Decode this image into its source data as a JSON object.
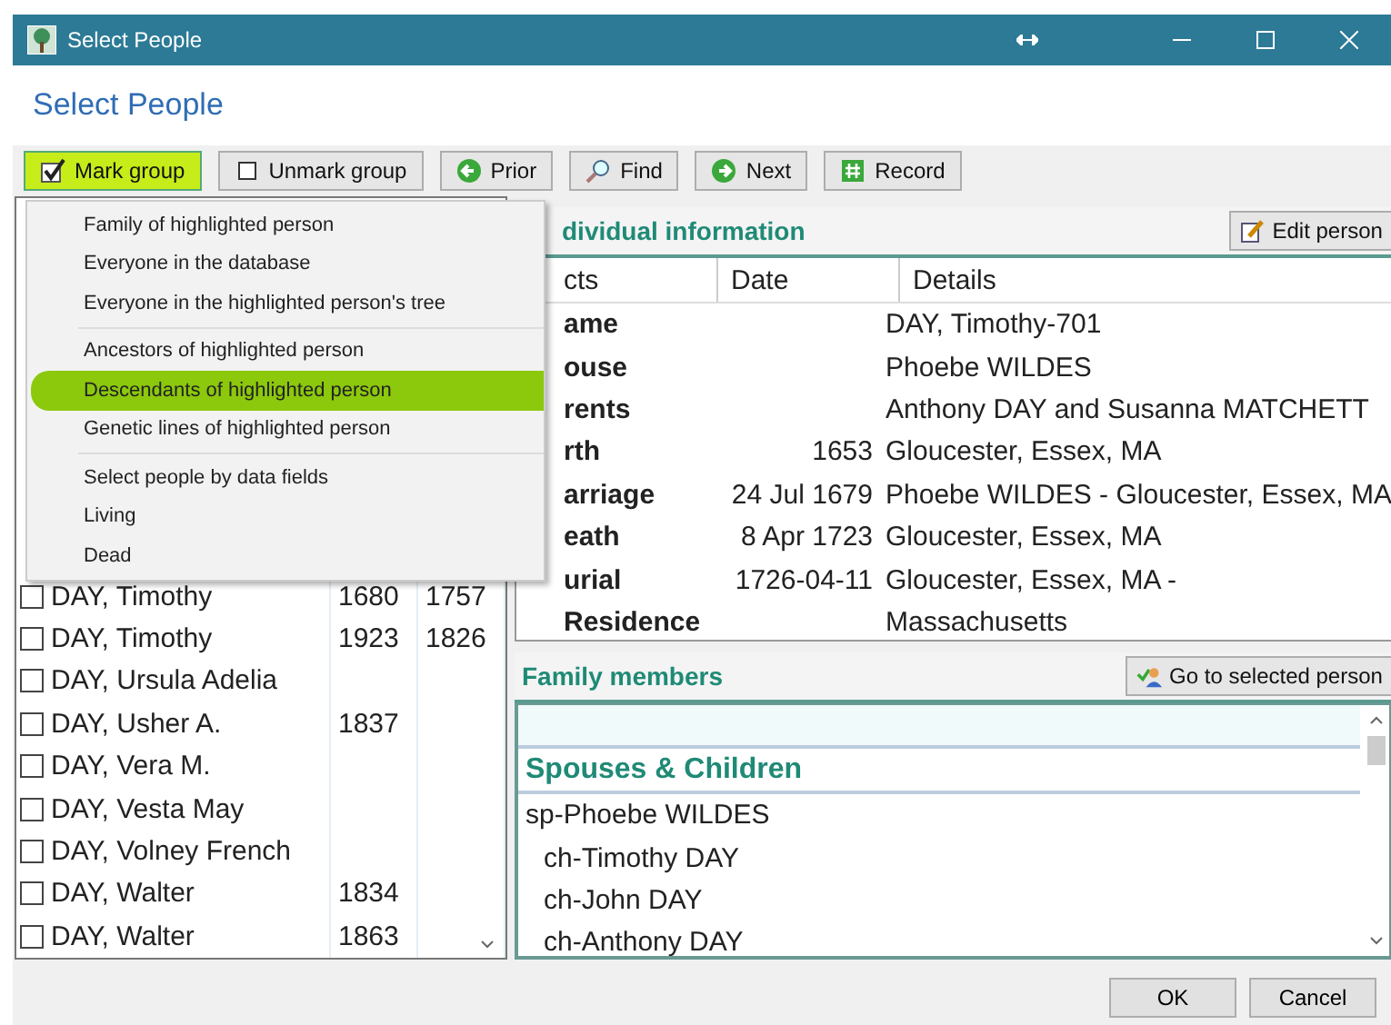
{
  "window": {
    "title": "Select People"
  },
  "heading": "Select People",
  "toolbar": [
    {
      "label": "Mark group",
      "kind": "check",
      "highlighted": true
    },
    {
      "label": "Unmark group",
      "kind": "box",
      "highlighted": false
    },
    {
      "label": "Prior",
      "kind": "prior",
      "highlighted": false
    },
    {
      "label": "Find",
      "kind": "find",
      "highlighted": false
    },
    {
      "label": "Next",
      "kind": "next",
      "highlighted": false
    },
    {
      "label": "Record",
      "kind": "record",
      "highlighted": false
    }
  ],
  "menu": {
    "sections": [
      [
        {
          "label": "Family of highlighted person",
          "selected": false
        },
        {
          "label": "Everyone in the database",
          "selected": false
        },
        {
          "label": "Everyone in the highlighted person's tree",
          "selected": false
        }
      ],
      [
        {
          "label": "Ancestors of highlighted person",
          "selected": false
        },
        {
          "label": "Descendants of highlighted person",
          "selected": true
        },
        {
          "label": "Genetic lines of highlighted person",
          "selected": false
        }
      ],
      [
        {
          "label": "Select people by data fields",
          "selected": false
        },
        {
          "label": "Living",
          "selected": false
        },
        {
          "label": "Dead",
          "selected": false
        }
      ]
    ]
  },
  "people": [
    {
      "name": "DAY, Timothy",
      "birth": "1680",
      "death": "1757",
      "checked": false
    },
    {
      "name": "DAY, Timothy",
      "birth": "1923",
      "death": "1826",
      "checked": false
    },
    {
      "name": "DAY, Ursula Adelia",
      "checked": false
    },
    {
      "name": "DAY, Usher A.",
      "birth": "1837",
      "checked": false
    },
    {
      "name": "DAY, Vera M.",
      "checked": false
    },
    {
      "name": "DAY, Vesta May",
      "checked": false
    },
    {
      "name": "DAY, Volney French",
      "checked": false
    },
    {
      "name": "DAY, Walter",
      "birth": "1834",
      "checked": false
    },
    {
      "name": "DAY, Walter",
      "birth": "1863",
      "checked": false
    }
  ],
  "individual": {
    "title": "dividual information",
    "edit_button": "Edit person",
    "columns": [
      "cts",
      "Date",
      "Details"
    ],
    "rows": [
      {
        "fact": "ame",
        "details": "DAY, Timothy-701"
      },
      {
        "fact": "ouse",
        "details": "Phoebe WILDES"
      },
      {
        "fact": "rents",
        "details": "Anthony DAY and Susanna MATCHETT"
      },
      {
        "fact": "rth",
        "date": "1653",
        "details": "Gloucester, Essex, MA"
      },
      {
        "fact": "arriage",
        "date": "24 Jul 1679",
        "details": "Phoebe WILDES - Gloucester, Essex, MA"
      },
      {
        "fact": "eath",
        "date": "8 Apr 1723",
        "details": "Gloucester, Essex, MA"
      },
      {
        "fact": "urial",
        "date": "1726-04-11",
        "details": "Gloucester, Essex, MA -"
      },
      {
        "fact": "Residence",
        "details": "Massachusetts"
      }
    ]
  },
  "family": {
    "title": "Family members",
    "go_button": "Go to selected person",
    "section": "Spouses & Children",
    "items": [
      {
        "kind": "spouse",
        "text": "sp-Phoebe WILDES"
      },
      {
        "kind": "child",
        "text": "ch-Timothy DAY"
      },
      {
        "kind": "child",
        "text": "ch-John DAY"
      },
      {
        "kind": "child",
        "text": "ch-Anthony DAY"
      }
    ]
  },
  "buttons": [
    "OK",
    "Cancel"
  ]
}
